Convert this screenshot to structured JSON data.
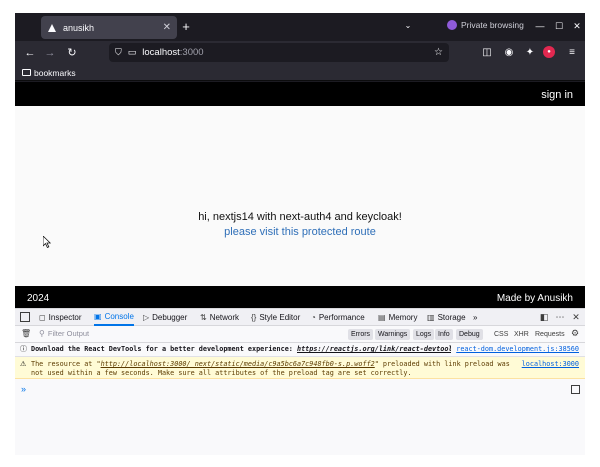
{
  "browser": {
    "tab_title": "anusikh",
    "private_label": "Private browsing",
    "url_host": "localhost",
    "url_port": ":3000",
    "bookmarks_label": "bookmarks"
  },
  "page": {
    "signin": "sign in",
    "greeting": "hi, nextjs14 with next-auth4 and keycloak!",
    "protected_link": "please visit this protected route",
    "year": "2024",
    "made_by": "Made by Anusikh"
  },
  "devtools": {
    "tabs": [
      "Inspector",
      "Console",
      "Debugger",
      "Network",
      "Style Editor",
      "Performance",
      "Memory",
      "Storage"
    ],
    "active_tab": "Console",
    "filter_placeholder": "Filter Output",
    "levels": [
      "Errors",
      "Warnings",
      "Logs",
      "Info",
      "Debug"
    ],
    "types": [
      "CSS",
      "XHR",
      "Requests"
    ],
    "messages": [
      {
        "prefix": "Download the React DevTools for a better development experience: ",
        "link": "https://reactjs.org/link/react-devtools",
        "source": "react-dom.development.js:38560"
      },
      {
        "prefix": "The resource at \"",
        "link": "http://localhost:3000/_next/static/media/c9a5bc6a7c948fb0-s.p.woff2",
        "suffix": "\" preloaded with link preload was not used within a few seconds. Make sure all attributes of the preload tag are set correctly.",
        "source": "localhost:3000"
      }
    ],
    "prompt": "»"
  }
}
